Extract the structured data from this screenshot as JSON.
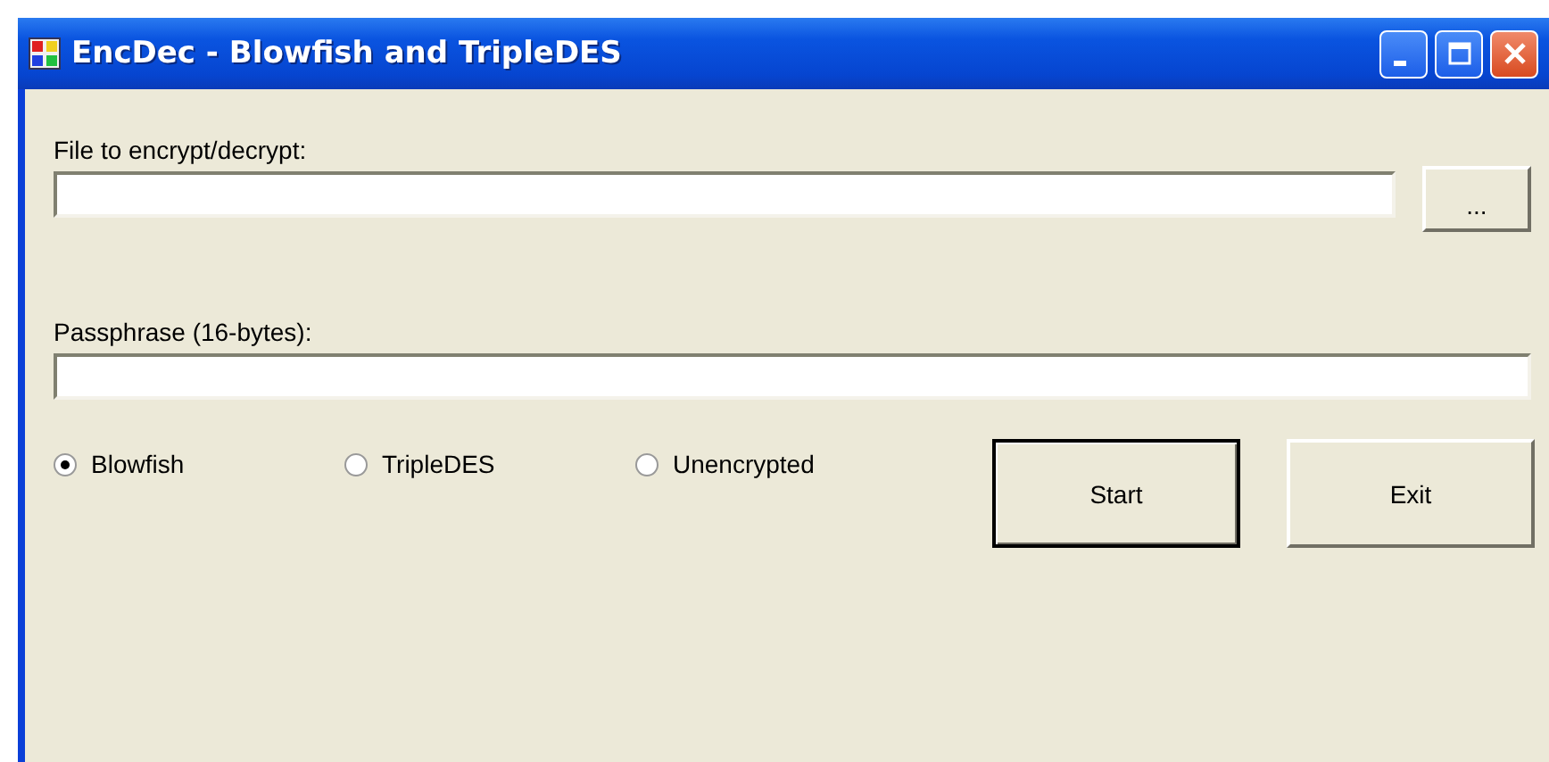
{
  "window": {
    "title": "EncDec - Blowfish and TripleDES"
  },
  "file_field": {
    "label": "File to encrypt/decrypt:"
  },
  "browse_button": {
    "label": "..."
  },
  "passphrase_field": {
    "label": "Passphrase (16-bytes):"
  },
  "algorithms": [
    {
      "label": "Blowfish",
      "selected": true
    },
    {
      "label": "TripleDES",
      "selected": false
    },
    {
      "label": "Unencrypted",
      "selected": false
    }
  ],
  "buttons": [
    {
      "label": "Start",
      "kind": "default"
    },
    {
      "label": "Exit",
      "kind": "normal"
    }
  ]
}
